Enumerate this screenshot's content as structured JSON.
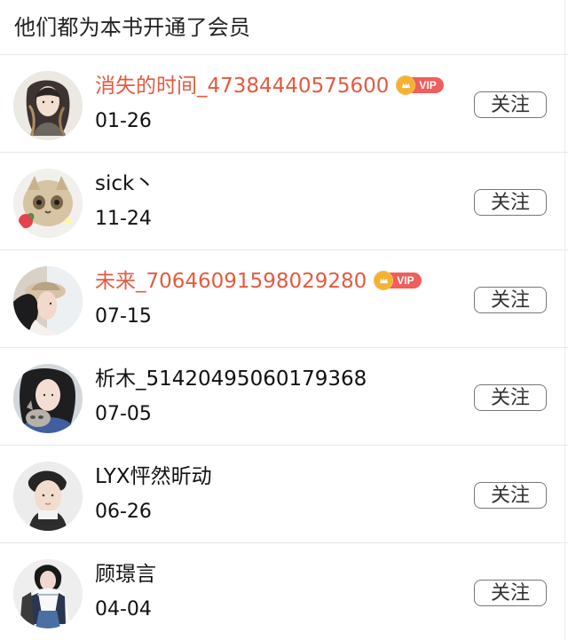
{
  "header": {
    "title": "他们都为本书开通了会员"
  },
  "members": [
    {
      "name": "消失的时间_47384440575600",
      "date": "01-26",
      "vip": true,
      "vip_badge_text": "VIP",
      "button_label": "关注",
      "avatar_icon": "anime-character-avatar"
    },
    {
      "name": "sick丶",
      "date": "11-24",
      "vip": false,
      "button_label": "关注",
      "avatar_icon": "cat-avatar"
    },
    {
      "name": "未来_70646091598029280",
      "date": "07-15",
      "vip": true,
      "vip_badge_text": "VIP",
      "button_label": "关注",
      "avatar_icon": "person-cap-avatar"
    },
    {
      "name": "析木_51420495060179368",
      "date": "07-05",
      "vip": false,
      "button_label": "关注",
      "avatar_icon": "person-with-cat-avatar"
    },
    {
      "name": "LYX怦然昕动",
      "date": "06-26",
      "vip": false,
      "button_label": "关注",
      "avatar_icon": "person-avatar"
    },
    {
      "name": "顾璟言",
      "date": "04-04",
      "vip": false,
      "button_label": "关注",
      "avatar_icon": "fashion-person-avatar"
    }
  ],
  "colors": {
    "vip_name": "#e45a3f",
    "vip_badge": "#ef5f5b",
    "crown": "#f3b234",
    "divider": "#e6e6e6",
    "button_border": "#777777"
  }
}
